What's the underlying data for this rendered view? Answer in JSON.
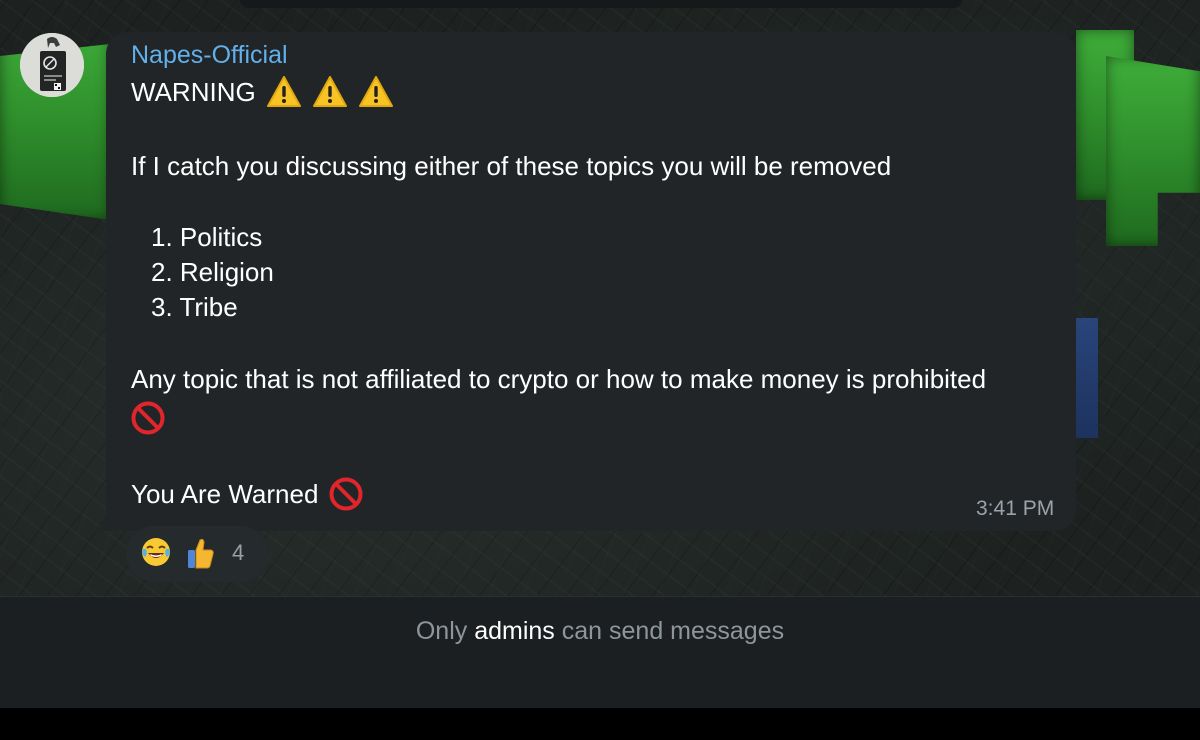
{
  "message": {
    "sender": "Napes-Official",
    "warning_title": "WARNING",
    "intro": "If I catch you discussing either of these topics you will be removed",
    "topics": [
      "1. Politics",
      "2. Religion",
      "3. Tribe"
    ],
    "rule": "Any topic that is not affiliated to crypto or how to make money is prohibited",
    "closing": "You Are Warned",
    "time": "3:41 PM"
  },
  "reactions": {
    "emojis": [
      "face-with-tears-of-joy-icon",
      "thumbs-up-icon"
    ],
    "count": "4"
  },
  "footer": {
    "prefix": "Only",
    "highlight": "admins",
    "suffix": "can send messages"
  },
  "colors": {
    "sender_name": "#62b0ea",
    "bubble": "#212528",
    "footer_bg": "#1b1f21",
    "wallpaper_green": "#3fae3a"
  }
}
